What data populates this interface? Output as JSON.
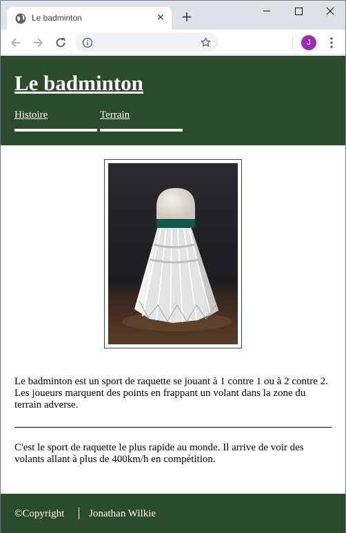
{
  "browser": {
    "tab_title": "Le badminton",
    "tab_close": "✕",
    "new_tab": "+",
    "avatar_letter": "J",
    "avatar_color": "#9d2cb8"
  },
  "header": {
    "title": "Le badminton",
    "nav": [
      "Histoire",
      "Terrain"
    ],
    "bg_color": "#2c4a2c"
  },
  "figure": {
    "subject": "badminton-shuttlecock-photo"
  },
  "content": {
    "paragraph_1": "Le badminton est un sport de raquette se jouant à 1 contre 1 ou à 2 contre 2. Les joueurs marquent des points en frappant un volant dans la zone du terrain adverse.",
    "paragraph_2": "C'est le sport de raquette le plus rapide au monde. Il arrive de voir des volants allant à plus de 400km/h en compétition."
  },
  "footer": {
    "copyright": "©Copyright",
    "author": "Jonathan Wilkie"
  }
}
